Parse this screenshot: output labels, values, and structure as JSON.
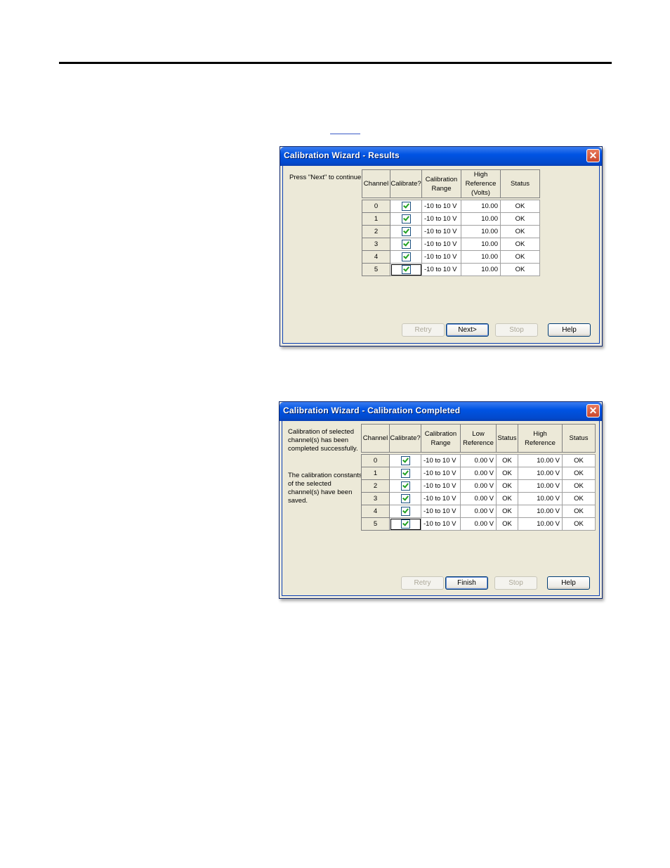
{
  "dialog1": {
    "title": "Calibration Wizard - Results",
    "close": "✕",
    "instruction": "Press \"Next\" to continue.",
    "columns": [
      "Channel",
      "Calibrate?",
      "Calibration\nRange",
      "High\nReference\n(Volts)",
      "Status"
    ],
    "rows": [
      {
        "channel": "0",
        "range": "-10 to 10 V",
        "high": "10.00",
        "status": "OK"
      },
      {
        "channel": "1",
        "range": "-10 to 10 V",
        "high": "10.00",
        "status": "OK"
      },
      {
        "channel": "2",
        "range": "-10 to 10 V",
        "high": "10.00",
        "status": "OK"
      },
      {
        "channel": "3",
        "range": "-10 to 10 V",
        "high": "10.00",
        "status": "OK"
      },
      {
        "channel": "4",
        "range": "-10 to 10 V",
        "high": "10.00",
        "status": "OK"
      },
      {
        "channel": "5",
        "range": "-10 to 10 V",
        "high": "10.00",
        "status": "OK"
      }
    ],
    "buttons": {
      "retry": "Retry",
      "next": "Next>",
      "stop": "Stop",
      "help": "Help"
    }
  },
  "dialog2": {
    "title": "Calibration Wizard - Calibration Completed",
    "close": "✕",
    "instruction1": "Calibration of selected\nchannel(s) has been\ncompleted successfully.",
    "instruction2": "The calibration constants\nof the selected\nchannel(s) have been\nsaved.",
    "columns": [
      "Channel",
      "Calibrate?",
      "Calibration\nRange",
      "Low\nReference",
      "Status",
      "High\nReference",
      "Status"
    ],
    "rows": [
      {
        "channel": "0",
        "range": "-10 to 10 V",
        "low": "0.00 V",
        "low_status": "OK",
        "high": "10.00 V",
        "high_status": "OK"
      },
      {
        "channel": "1",
        "range": "-10 to 10 V",
        "low": "0.00 V",
        "low_status": "OK",
        "high": "10.00 V",
        "high_status": "OK"
      },
      {
        "channel": "2",
        "range": "-10 to 10 V",
        "low": "0.00 V",
        "low_status": "OK",
        "high": "10.00 V",
        "high_status": "OK"
      },
      {
        "channel": "3",
        "range": "-10 to 10 V",
        "low": "0.00 V",
        "low_status": "OK",
        "high": "10.00 V",
        "high_status": "OK"
      },
      {
        "channel": "4",
        "range": "-10 to 10 V",
        "low": "0.00 V",
        "low_status": "OK",
        "high": "10.00 V",
        "high_status": "OK"
      },
      {
        "channel": "5",
        "range": "-10 to 10 V",
        "low": "0.00 V",
        "low_status": "OK",
        "high": "10.00 V",
        "high_status": "OK"
      }
    ],
    "buttons": {
      "retry": "Retry",
      "finish": "Finish",
      "stop": "Stop",
      "help": "Help"
    }
  },
  "colors": {
    "titlebar": "#0054e3",
    "dialog_bg": "#ece9d8",
    "check": "#21a121"
  }
}
